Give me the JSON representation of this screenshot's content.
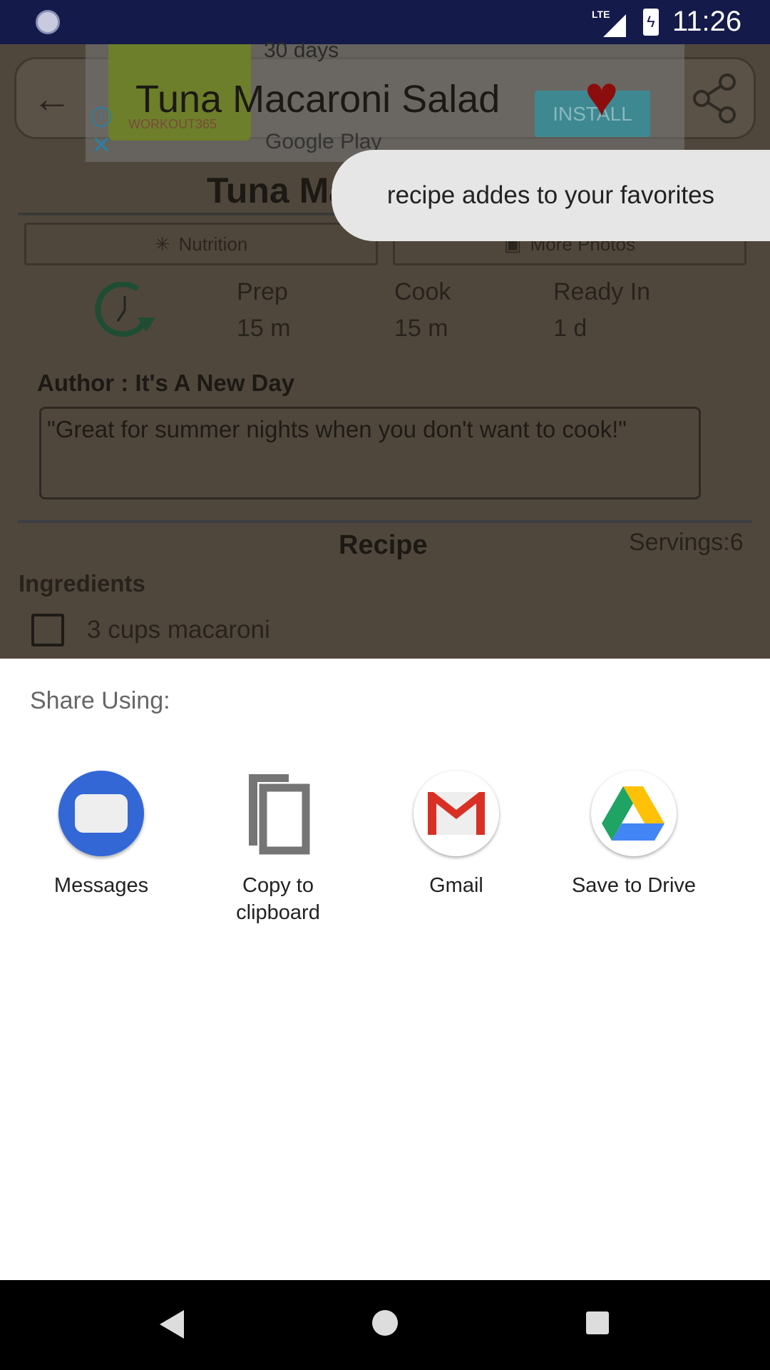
{
  "status_bar": {
    "time": "11:26",
    "network": "LTE"
  },
  "app_bar": {
    "title": "Tuna Macaroni Salad"
  },
  "ad": {
    "headline": "30 days",
    "brand": "WORKOUT365",
    "store": "Google Play",
    "install_label": "INSTALL"
  },
  "toast": {
    "message": "recipe addes to your favorites"
  },
  "recipe": {
    "title": "Tuna Macaroni Salad",
    "tabs": [
      "Nutrition",
      "More Photos"
    ],
    "times": [
      {
        "label": "Prep",
        "value": "15 m"
      },
      {
        "label": "Cook",
        "value": "15 m"
      },
      {
        "label": "Ready In",
        "value": "1 d"
      }
    ],
    "author": "Author : It's A New Day",
    "quote": "\"Great for summer nights when you don't want to cook!\"",
    "section": "Recipe",
    "servings": "Servings:6",
    "ingredients_label": "Ingredients",
    "ingredients": [
      "3 cups macaroni"
    ]
  },
  "share_sheet": {
    "title": "Share Using:",
    "targets": [
      {
        "label": "Messages",
        "icon": "messages-icon",
        "color": "#3367d6"
      },
      {
        "label": "Copy to clipboard",
        "icon": "copy-icon",
        "color": "#757575"
      },
      {
        "label": "Gmail",
        "icon": "gmail-icon",
        "color": "#d93025"
      },
      {
        "label": "Save to Drive",
        "icon": "drive-icon",
        "color": "#1fa463"
      }
    ]
  }
}
